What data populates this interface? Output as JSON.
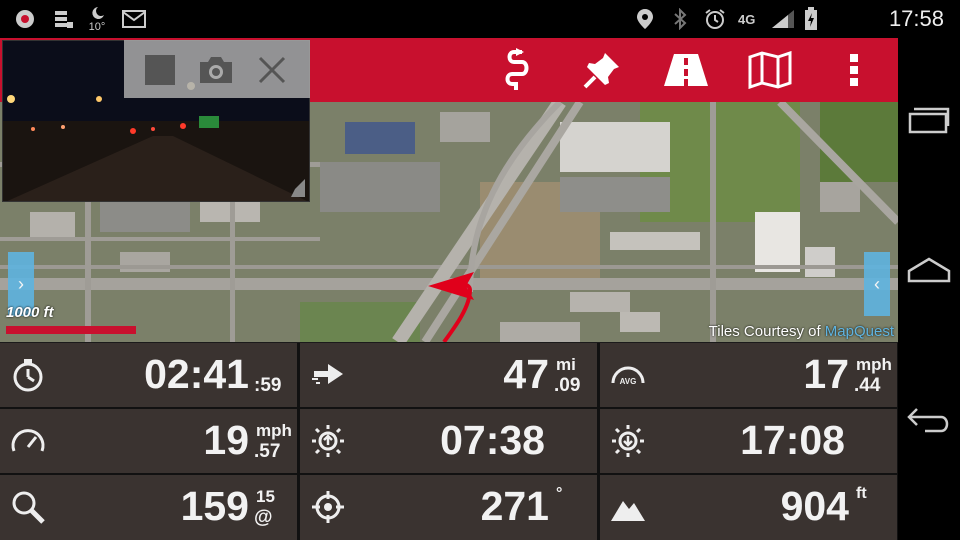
{
  "status_bar": {
    "time": "17:58",
    "weather_temp": "10°",
    "network": "4G",
    "left_icons": [
      "record-icon",
      "notification-icon",
      "weather-moon-icon",
      "gmail-icon"
    ],
    "right_icons": [
      "location-icon",
      "bluetooth-icon",
      "alarm-icon",
      "signal-icon",
      "battery-icon"
    ]
  },
  "toolbar": {
    "background": "#c8102e",
    "buttons": [
      "route-icon",
      "pushpin-icon",
      "road-icon",
      "map-icon",
      "more-icon"
    ]
  },
  "dashcam": {
    "controls": [
      "stop-button",
      "camera-button",
      "close-button"
    ]
  },
  "map": {
    "scale_label": "1000 ft",
    "attribution_prefix": "Tiles Courtesy of ",
    "attribution_link": "MapQuest",
    "left_tab": "›",
    "right_tab": "‹"
  },
  "stats": [
    {
      "id": "elapsed",
      "icon": "stopwatch-icon",
      "value": "02:41",
      "unit_top": "",
      "unit_bottom": ":59"
    },
    {
      "id": "distance",
      "icon": "distance-arrow-icon",
      "value": "47",
      "unit_top": "mi",
      "unit_bottom": ".09"
    },
    {
      "id": "avg-speed",
      "icon": "avg-gauge-icon",
      "value": "17",
      "unit_top": "mph",
      "unit_bottom": ".44"
    },
    {
      "id": "speed",
      "icon": "speedometer-icon",
      "value": "19",
      "unit_top": "mph",
      "unit_bottom": ".57"
    },
    {
      "id": "sunrise",
      "icon": "sunrise-icon",
      "value": "07:38",
      "unit_top": "",
      "unit_bottom": ""
    },
    {
      "id": "sunset",
      "icon": "sunset-icon",
      "value": "17:08",
      "unit_top": "",
      "unit_bottom": ""
    },
    {
      "id": "satellites",
      "icon": "search-icon",
      "value": "159",
      "unit_top": "15",
      "unit_bottom": "@"
    },
    {
      "id": "heading",
      "icon": "crosshair-icon",
      "value": "271",
      "unit_top": "°",
      "unit_bottom": ""
    },
    {
      "id": "elevation",
      "icon": "mountain-icon",
      "value": "904",
      "unit_top": "ft",
      "unit_bottom": ""
    }
  ],
  "nav_bar": {
    "buttons": [
      "recent-apps-icon",
      "home-icon",
      "back-icon"
    ]
  }
}
